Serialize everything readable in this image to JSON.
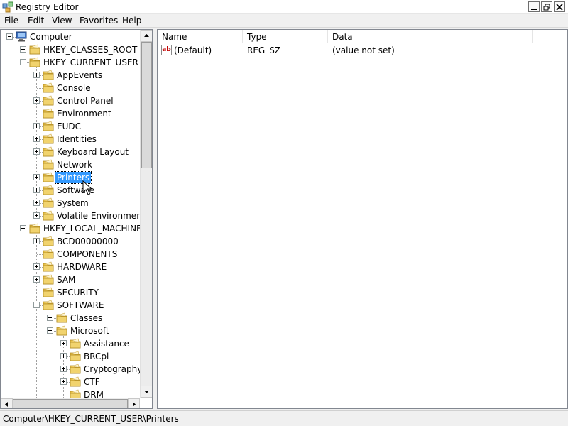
{
  "window": {
    "title": "Registry Editor"
  },
  "menu": [
    "File",
    "Edit",
    "View",
    "Favorites",
    "Help"
  ],
  "tree": {
    "nodes": [
      {
        "label": "Computer",
        "icon": "computer-icon",
        "expander": "minus"
      },
      {
        "label": "HKEY_CLASSES_ROOT",
        "expander": "plus"
      },
      {
        "label": "HKEY_CURRENT_USER",
        "expander": "minus"
      },
      {
        "label": "AppEvents",
        "expander": "plus"
      },
      {
        "label": "Console",
        "expander": "none"
      },
      {
        "label": "Control Panel",
        "expander": "plus"
      },
      {
        "label": "Environment",
        "expander": "none"
      },
      {
        "label": "EUDC",
        "expander": "plus"
      },
      {
        "label": "Identities",
        "expander": "plus"
      },
      {
        "label": "Keyboard Layout",
        "expander": "plus"
      },
      {
        "label": "Network",
        "expander": "none"
      },
      {
        "label": "Printers",
        "expander": "plus",
        "selected": true
      },
      {
        "label": "Software",
        "expander": "plus"
      },
      {
        "label": "System",
        "expander": "plus"
      },
      {
        "label": "Volatile Environment",
        "expander": "plus"
      },
      {
        "label": "HKEY_LOCAL_MACHINE",
        "expander": "minus"
      },
      {
        "label": "BCD00000000",
        "expander": "plus"
      },
      {
        "label": "COMPONENTS",
        "expander": "none"
      },
      {
        "label": "HARDWARE",
        "expander": "plus"
      },
      {
        "label": "SAM",
        "expander": "plus"
      },
      {
        "label": "SECURITY",
        "expander": "none"
      },
      {
        "label": "SOFTWARE",
        "expander": "minus"
      },
      {
        "label": "Classes",
        "expander": "plus"
      },
      {
        "label": "Microsoft",
        "expander": "minus"
      },
      {
        "label": "Assistance",
        "expander": "plus"
      },
      {
        "label": "BRCpl",
        "expander": "plus"
      },
      {
        "label": "Cryptography",
        "expander": "plus"
      },
      {
        "label": "CTF",
        "expander": "plus"
      },
      {
        "label": "DRM",
        "expander": "none"
      }
    ]
  },
  "list": {
    "columns": [
      "Name",
      "Type",
      "Data"
    ],
    "rows": [
      {
        "name": "(Default)",
        "type": "REG_SZ",
        "data": "(value not set)",
        "icon": "string-value-icon"
      }
    ]
  },
  "status": {
    "path": "Computer\\HKEY_CURRENT_USER\\Printers"
  },
  "colors": {
    "selection": "#3399ff",
    "folder": "#e8c14a",
    "border": "#828790"
  }
}
